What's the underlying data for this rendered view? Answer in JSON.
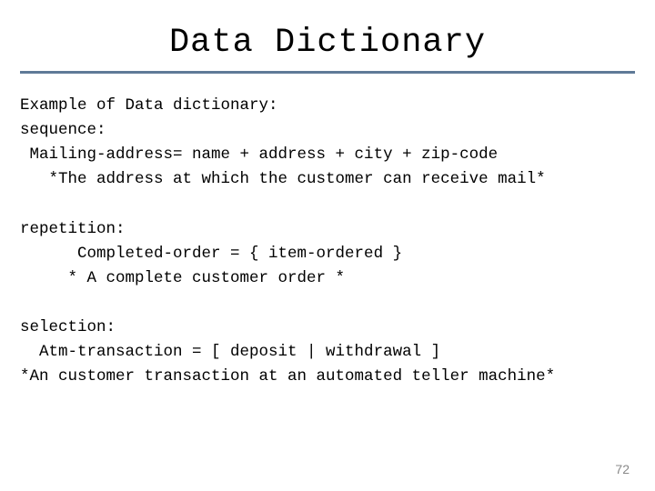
{
  "title": "Data Dictionary",
  "lines": {
    "l1": "Example of Data dictionary:",
    "l2": "sequence:",
    "l3": " Mailing-address= name + address + city + zip-code",
    "l4": "   *The address at which the customer can receive mail*",
    "gap1": "",
    "l5": "repetition:",
    "l6": "      Completed-order = { item-ordered }",
    "l7": "     * A complete customer order *",
    "gap2": "",
    "l8": "selection:",
    "l9": "  Atm-transaction = [ deposit | withdrawal ]",
    "l10": "*An customer transaction at an automated teller machine*"
  },
  "page_number": "72",
  "colors": {
    "rule": "#5f7a97"
  }
}
